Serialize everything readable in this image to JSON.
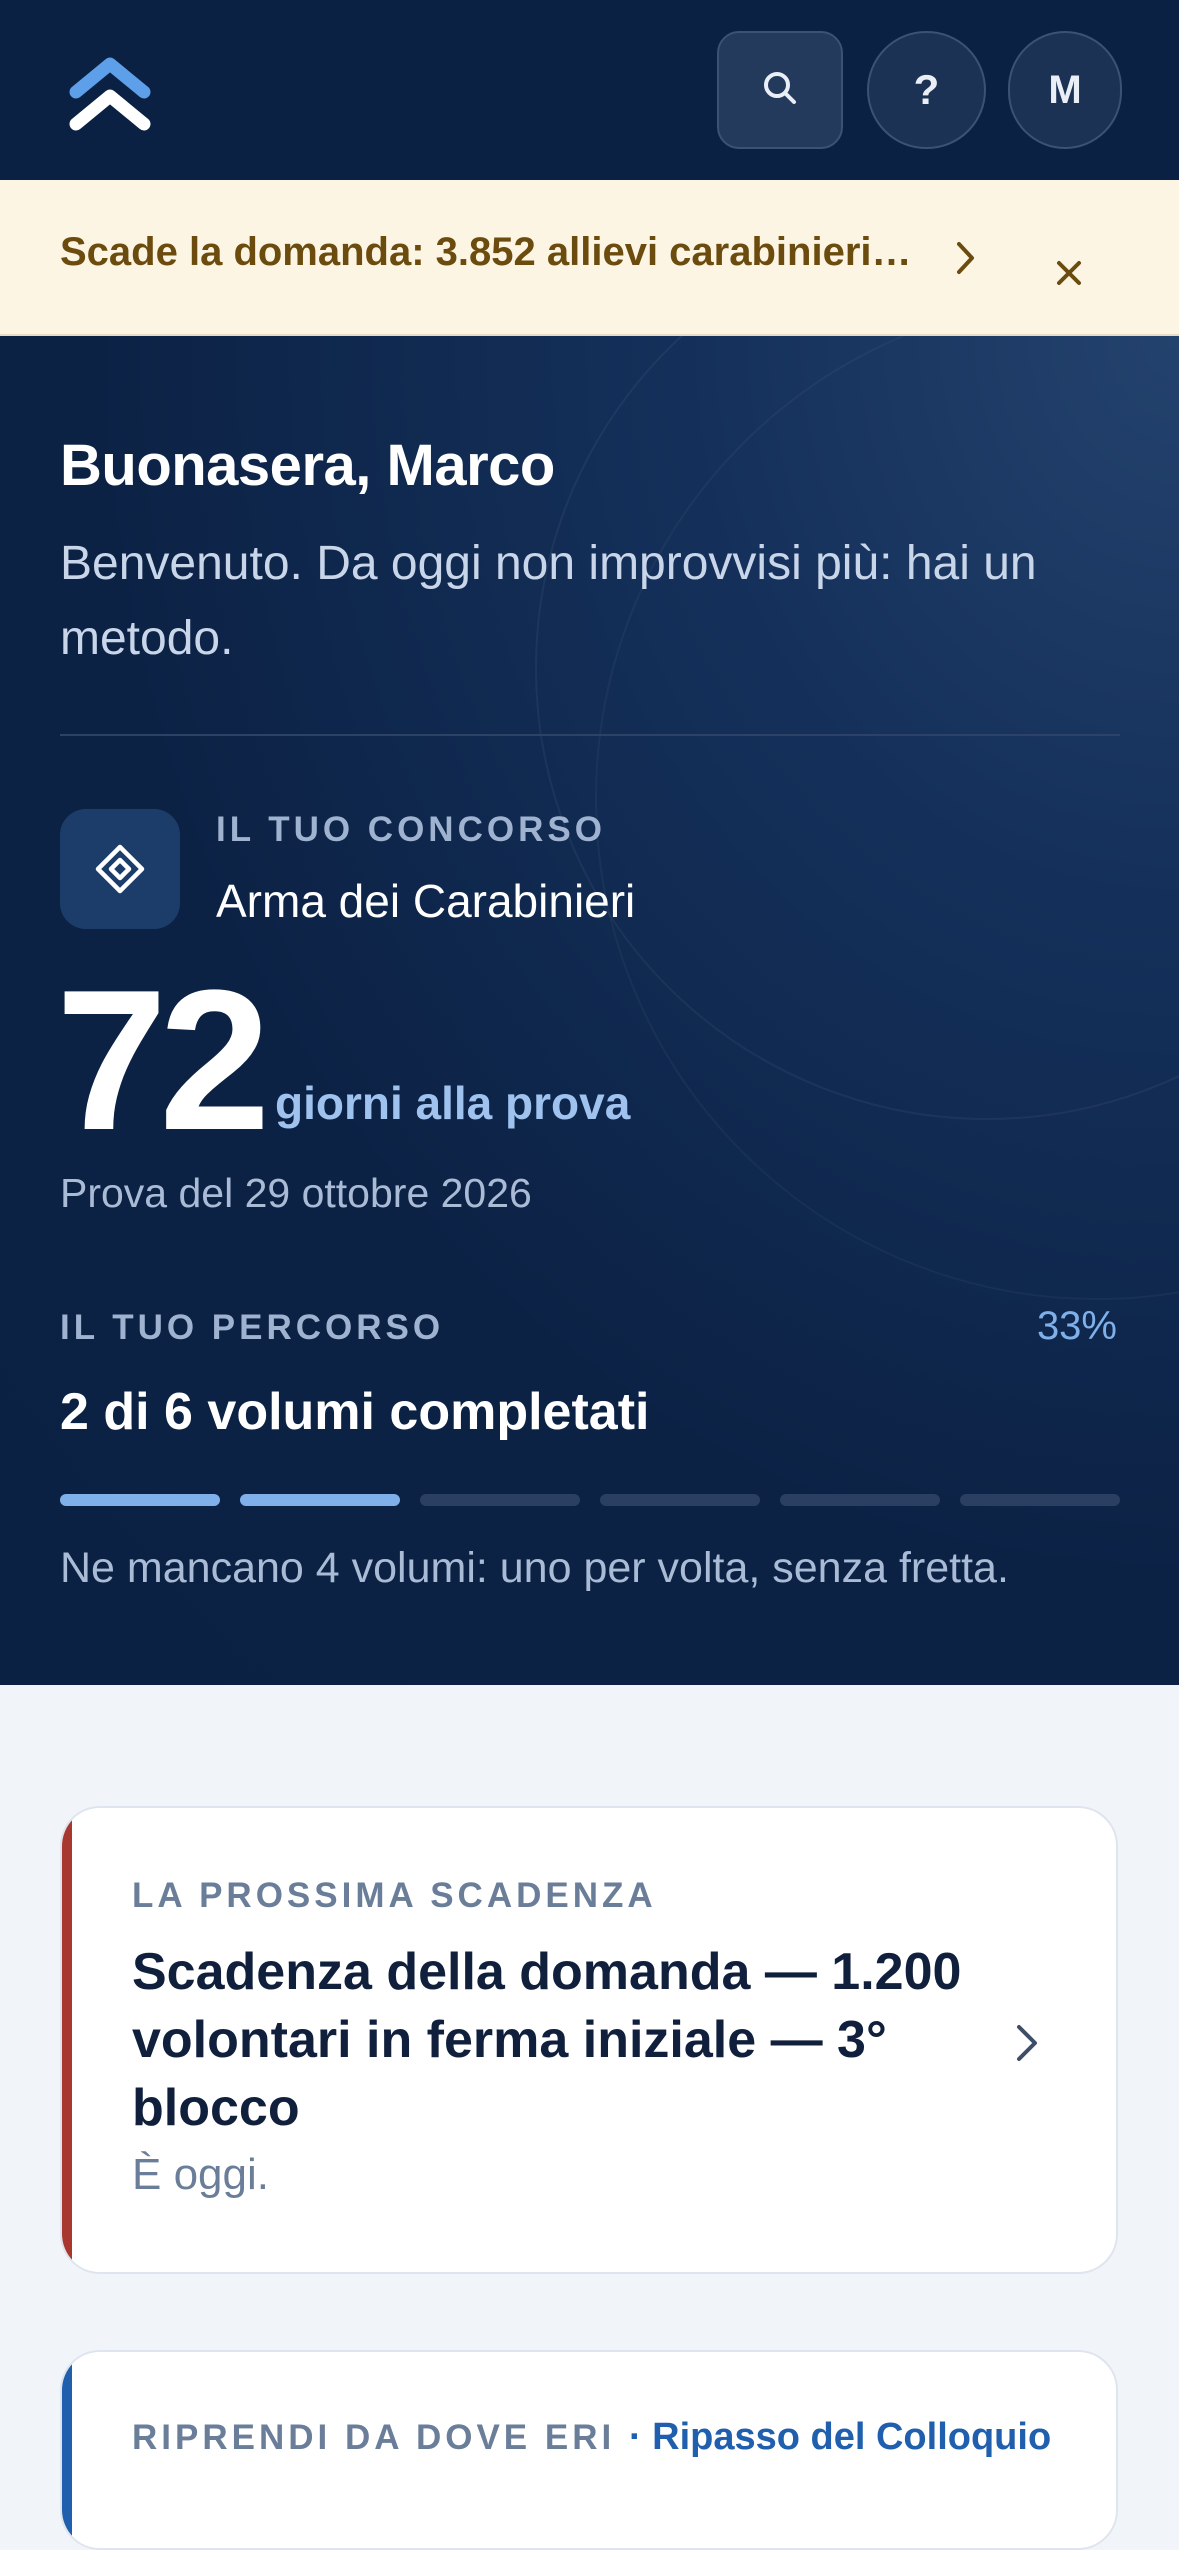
{
  "header": {
    "logo_icon": "chevrons-up-icon",
    "search_icon": "search-icon",
    "help_label": "?",
    "avatar_initial": "M"
  },
  "banner": {
    "text": "Scade la domanda: 3.852 allievi carabinieri…",
    "chevron_icon": "chevron-right-icon",
    "close_icon": "close-icon"
  },
  "hero": {
    "greeting": "Buonasera, Marco",
    "welcome": "Benvenuto. Da oggi non improvvisi più: hai un metodo.",
    "contest": {
      "label": "IL TUO CONCORSO",
      "name": "Arma dei Carabinieri",
      "icon": "diamond-icon"
    },
    "countdown": {
      "days": "72",
      "days_label": "giorni alla prova",
      "exam_date": "Prova del 29 ottobre 2026"
    },
    "path": {
      "label": "IL TUO PERCORSO",
      "percent": "33%",
      "status": "2 di 6 volumi completati",
      "completed_volumes": 2,
      "total_volumes": 6,
      "hint": "Ne mancano 4 volumi: uno per volta, senza fretta."
    }
  },
  "cards": [
    {
      "label": "LA PROSSIMA SCADENZA",
      "title": "Scadenza della domanda — 1.200 volontari in ferma iniziale — 3° blocco",
      "subtitle": "È oggi.",
      "accent_color": "#a8382f",
      "chevron_icon": "chevron-right-icon"
    },
    {
      "label": "RIPRENDI DA DOVE ERI",
      "link": "· Ripasso del Colloquio",
      "accent_color": "#1f5fae"
    }
  ],
  "colors": {
    "navy": "#0b2143",
    "banner_bg": "#fdf5e4",
    "accent_blue": "#7fb0ea",
    "deadline_red": "#a8382f"
  }
}
